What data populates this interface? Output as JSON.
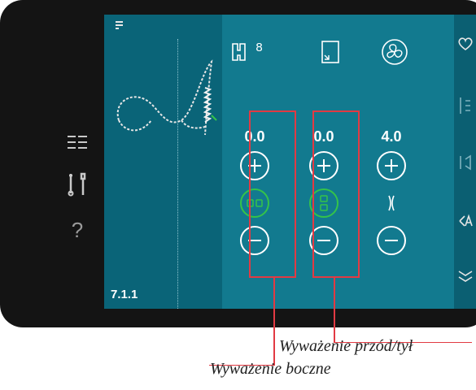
{
  "parameters": [
    {
      "id": "side-balance",
      "value": "0.0"
    },
    {
      "id": "front-back-balance",
      "value": "0.0"
    },
    {
      "id": "width",
      "value": "4.0"
    }
  ],
  "step_label": "7.1.1",
  "presser_foot_number": "8",
  "callouts": {
    "front_back": "Wyważenie przód/tył",
    "side": "Wyważenie boczne"
  },
  "left_menu": {
    "help_glyph": "?"
  },
  "colors": {
    "screen": "#0f6d81",
    "highlight_box": "#e23a43",
    "active_control": "#34c34a"
  }
}
